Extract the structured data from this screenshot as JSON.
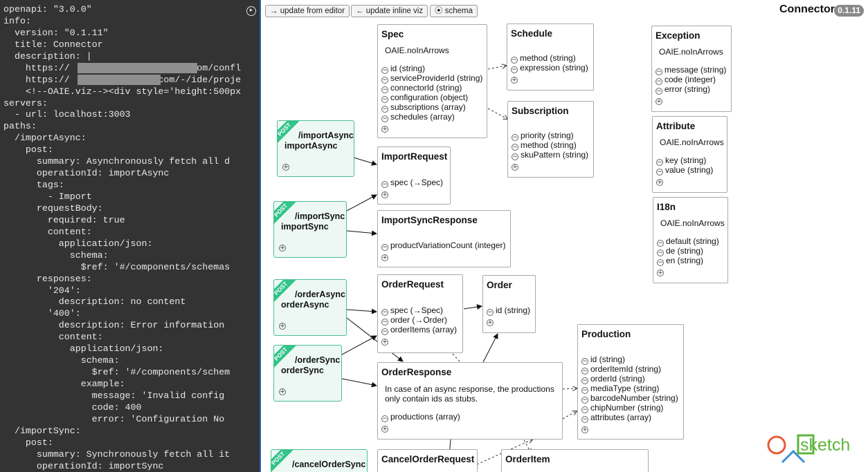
{
  "editor": {
    "lines": [
      "openapi: \"3.0.0\"",
      "info:",
      "  version: \"0.1.11\"",
      "  title: Connector",
      "  description: |",
      "    https://                    s.com/confl",
      "    https://              s.com/-/ide/proje",
      "    <!--OAIE.viz--><div style='height:500px",
      "servers:",
      "  - url: localhost:3003",
      "paths:",
      "  /importAsync:",
      "    post:",
      "      summary: Asynchronously fetch all d",
      "      operationId: importAsync",
      "      tags:",
      "        - Import",
      "      requestBody:",
      "        required: true",
      "        content:",
      "          application/json:",
      "            schema:",
      "              $ref: '#/components/schemas",
      "      responses:",
      "        '204':",
      "          description: no content",
      "        '400':",
      "          description: Error information",
      "          content:",
      "            application/json:",
      "              schema:",
      "                $ref: '#/components/schem",
      "              example:",
      "                message: 'Invalid config",
      "                code: 400",
      "                error: 'Configuration No",
      "  /importSync:",
      "    post:",
      "      summary: Synchronously fetch all it",
      "      operationId: importSync"
    ],
    "toggle_icon": "circle-arrow-icon"
  },
  "toolbar": {
    "update_from_editor": "→ update from editor",
    "update_inline_viz": "← update inline viz",
    "schema": "⦿ schema"
  },
  "header": {
    "title": "Connector",
    "version": "0.1.11"
  },
  "operations": [
    {
      "method": "POST",
      "path": "/importAsync",
      "operation_id": "importAsync"
    },
    {
      "method": "POST",
      "path": "/importSync",
      "operation_id": "importSync"
    },
    {
      "method": "POST",
      "path": "/orderAsync",
      "operation_id": "orderAsync"
    },
    {
      "method": "POST",
      "path": "/orderSync",
      "operation_id": "orderSync"
    },
    {
      "method": "POST",
      "path": "/cancelOrderSync",
      "operation_id": "cancelOrderSync"
    }
  ],
  "schemas": {
    "spec": {
      "name": "Spec",
      "description": "OAIE.noInArrows",
      "props": [
        "id (string)",
        "serviceProviderId (string)",
        "connectorId (string)",
        "configuration (object)",
        "subscriptions (array)",
        "schedules (array)"
      ]
    },
    "schedule": {
      "name": "Schedule",
      "props": [
        "method (string)",
        "expression (string)"
      ]
    },
    "subscription": {
      "name": "Subscription",
      "props": [
        "priority (string)",
        "method (string)",
        "skuPattern (string)"
      ]
    },
    "exception": {
      "name": "Exception",
      "description": "OAIE.noInArrows",
      "props": [
        "message (string)",
        "code (integer)",
        "error (string)"
      ]
    },
    "attribute": {
      "name": "Attribute",
      "description": "OAIE.noInArrows",
      "props": [
        "key (string)",
        "value (string)"
      ]
    },
    "i18n": {
      "name": "I18n",
      "description": "OAIE.noInArrows",
      "props": [
        "default (string)",
        "de (string)",
        "en (string)"
      ]
    },
    "import_request": {
      "name": "ImportRequest",
      "props": [
        "spec (→Spec)"
      ]
    },
    "import_sync_response": {
      "name": "ImportSyncResponse",
      "props": [
        "productVariationCount (integer)"
      ]
    },
    "order_request": {
      "name": "OrderRequest",
      "props": [
        "spec (→Spec)",
        "order (→Order)",
        "orderItems (array)"
      ]
    },
    "order": {
      "name": "Order",
      "props": [
        "id (string)"
      ]
    },
    "order_response": {
      "name": "OrderResponse",
      "description_lines": [
        "In case of an async response, the productions",
        "only contain ids as stubs."
      ],
      "props": [
        "productions (array)"
      ]
    },
    "production": {
      "name": "Production",
      "props": [
        "id (string)",
        "orderItemId (string)",
        "orderId (string)",
        "mediaType (string)",
        "barcodeNumber (string)",
        "chipNumber (string)",
        "attributes (array)"
      ]
    },
    "cancel_order_request": {
      "name": "CancelOrderRequest",
      "props": []
    },
    "order_item": {
      "name": "OrderItem",
      "props": []
    }
  },
  "logo": {
    "text": "sketch",
    "colors": {
      "red": "#ea5a3a",
      "blue": "#3f8fd6",
      "green": "#5db53b"
    }
  },
  "colors": {
    "editor_bg": "#333333",
    "op_border": "#4bbf8f",
    "op_ribbon": "#32c48a",
    "op_bg": "#edf8f4"
  }
}
